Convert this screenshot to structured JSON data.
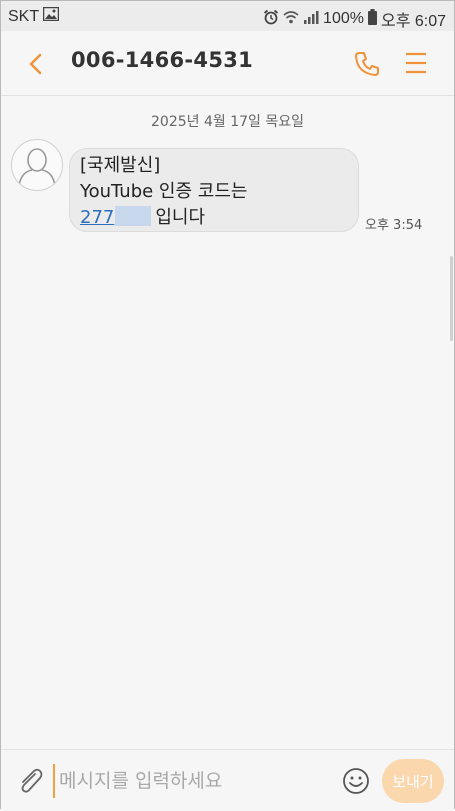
{
  "status_bar": {
    "carrier": "SKT",
    "battery": "100%",
    "time": "오후 6:07"
  },
  "header": {
    "title": "006-1466-4531"
  },
  "conversation": {
    "date_label": "2025년 4월 17일 목요일",
    "message": {
      "line1": "[국제발신]",
      "line2": "YouTube 인증 코드는",
      "code_visible": "277",
      "suffix": "입니다",
      "time": "오후 3:54"
    }
  },
  "composer": {
    "placeholder": "메시지를 입력하세요",
    "send_label": "보내기"
  },
  "colors": {
    "accent": "#f0923a",
    "link": "#2a6ebd",
    "send_disabled": "#fbd7ad"
  }
}
